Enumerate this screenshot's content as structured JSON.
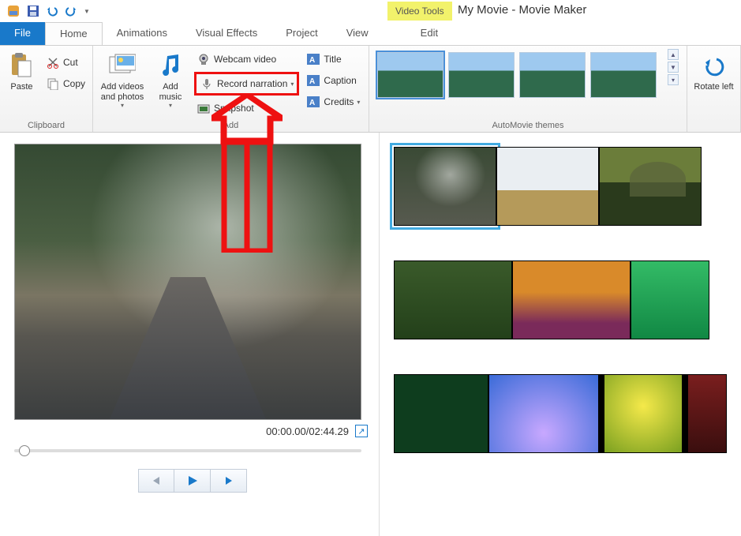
{
  "title": "My Movie - Movie Maker",
  "contextual_tab": "Video Tools",
  "tabs": {
    "file": "File",
    "home": "Home",
    "animations": "Animations",
    "visual_effects": "Visual Effects",
    "project": "Project",
    "view": "View",
    "edit": "Edit"
  },
  "ribbon": {
    "clipboard": {
      "label": "Clipboard",
      "paste": "Paste",
      "cut": "Cut",
      "copy": "Copy"
    },
    "add": {
      "label": "Add",
      "add_videos": "Add videos and photos",
      "add_music": "Add music",
      "webcam": "Webcam video",
      "record_narration": "Record narration",
      "snapshot": "Snapshot",
      "title": "Title",
      "caption": "Caption",
      "credits": "Credits"
    },
    "themes": {
      "label": "AutoMovie themes"
    },
    "rotate": {
      "left": "Rotate left"
    }
  },
  "playback": {
    "current": "00:00.00",
    "total": "02:44.29"
  }
}
